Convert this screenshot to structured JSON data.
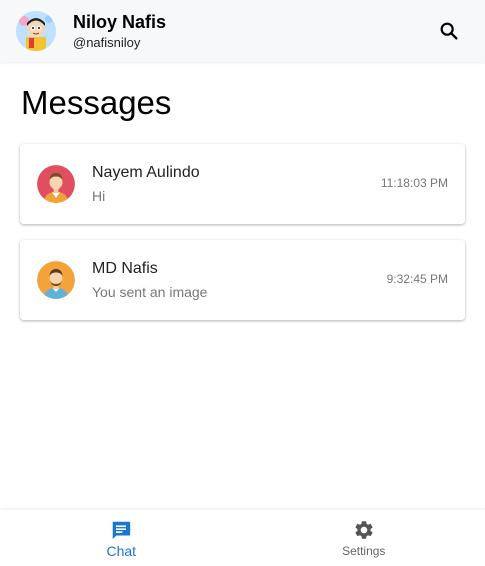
{
  "header": {
    "user_name": "Niloy Nafis",
    "user_handle": "@nafisniloy",
    "avatar_icon": "cartoon-avatar-icon",
    "search_icon": "search-icon"
  },
  "main": {
    "title": "Messages",
    "conversations": [
      {
        "name": "Nayem Aulindo",
        "preview": "Hi",
        "time": "11:18:03 PM",
        "avatar_icon": "person-avatar-icon",
        "avatar_color": "#e04f5f"
      },
      {
        "name": "MD Nafis",
        "preview": "You sent an image",
        "time": "9:32:45 PM",
        "avatar_icon": "person-avatar-icon",
        "avatar_color": "#f4a33b"
      }
    ]
  },
  "bottom_nav": {
    "items": [
      {
        "label": "Chat",
        "icon": "chat-icon",
        "active": true
      },
      {
        "label": "Settings",
        "icon": "gear-icon",
        "active": false
      }
    ]
  },
  "colors": {
    "accent": "#1976d2",
    "header_bg": "#f7f8fa",
    "muted_text": "#777777"
  }
}
